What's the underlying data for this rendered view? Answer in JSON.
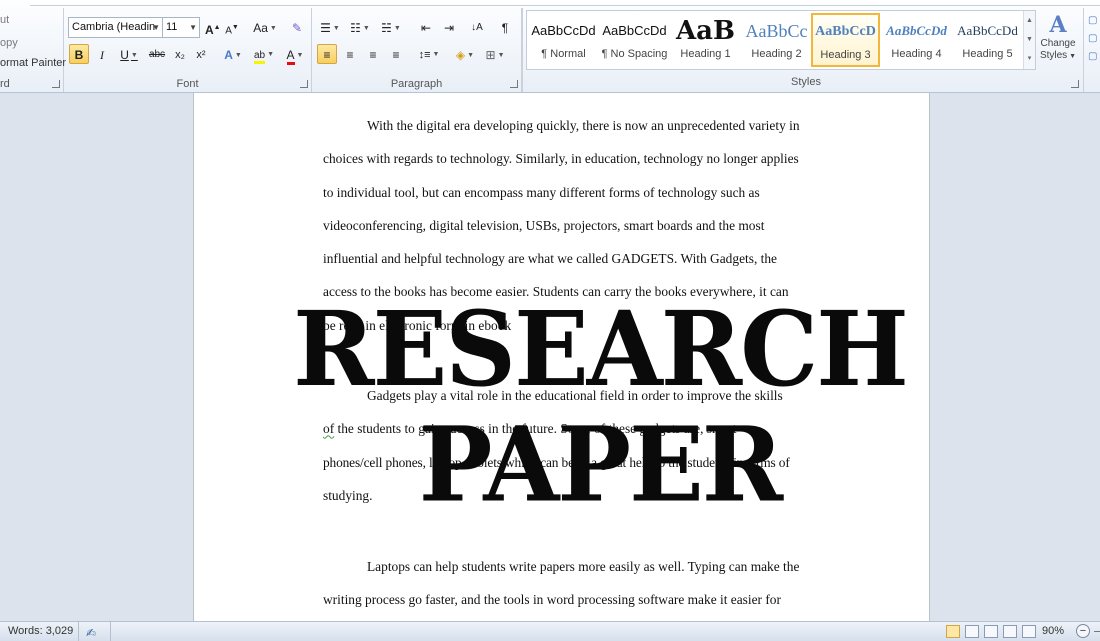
{
  "clipboard": {
    "label": "rd",
    "items": [
      "ut",
      "opy",
      "ormat Painter"
    ]
  },
  "font": {
    "label": "Font",
    "name": "Cambria (Headin",
    "size": "11",
    "grow": "A",
    "shrink": "A",
    "case": "Aa",
    "clear": "✎",
    "bold": "B",
    "italic": "I",
    "underline": "U",
    "strike": "abc",
    "subscript": "x₂",
    "superscript": "x²",
    "effects": "A",
    "highlight": "ab",
    "color": "A",
    "highlight_color": "#f5f500",
    "font_color": "#e01010"
  },
  "paragraph": {
    "label": "Paragraph",
    "bullets": "☰",
    "numbering": "☷",
    "multilevel": "☵",
    "decrease_indent": "⇤",
    "increase_indent": "⇥",
    "sort": "↓A",
    "pilcrow": "¶",
    "align_left": "≡",
    "align_center": "≡",
    "align_right": "≡",
    "justify": "≡",
    "line_spacing": "↕≡",
    "shading": "◈",
    "borders": "⊞"
  },
  "styles": {
    "label": "Styles",
    "change_styles_line1": "Change",
    "change_styles_line2": "Styles",
    "items": [
      {
        "preview": "AaBbCcDd",
        "name": "¶ Normal"
      },
      {
        "preview": "AaBbCcDd",
        "name": "¶ No Spacing"
      },
      {
        "preview": "AaB",
        "name": "Heading 1"
      },
      {
        "preview": "AaBbCc",
        "name": "Heading 2"
      },
      {
        "preview": "AaBbCcD",
        "name": "Heading 3"
      },
      {
        "preview": "AaBbCcDd",
        "name": "Heading 4"
      },
      {
        "preview": "AaBbCcDd",
        "name": "Heading 5"
      }
    ],
    "selected": "Heading 3"
  },
  "document": {
    "paragraphs": [
      {
        "lines": [
          "With the digital era developing quickly, there is now an unprecedented variety in",
          "choices with regards to technology. Similarly, in education, technology no longer applies",
          "to individual tool, but can encompass many different forms of technology such as",
          "videoconferencing, digital television, USBs, projectors, smart boards and the most",
          "influential and helpful technology are what we called GADGETS. With Gadgets, the",
          "access to the books has become easier. Students can carry the books everywhere, it can",
          "be read in electronic form in ebook"
        ]
      },
      {
        "lines": [
          "Gadgets play a vital role in the educational field in order to improve the skills",
          "of the students to gain success in the future. Some of these gadgets are, smart",
          "phones/cell phones, laptop, tablets which can be of a great help to the students in terms of",
          "studying."
        ]
      },
      {
        "lines": [
          "Laptops can help students write papers more easily as well. Typing can make the",
          "writing process go faster, and the tools in word processing software make it easier for"
        ]
      }
    ],
    "squiggle_word": "of",
    "watermark": "RESEARCH PAPER"
  },
  "statusbar": {
    "words": "Words: 3,029",
    "zoom": "90%",
    "zoom_minus": "−",
    "zoom_plus": "+"
  }
}
